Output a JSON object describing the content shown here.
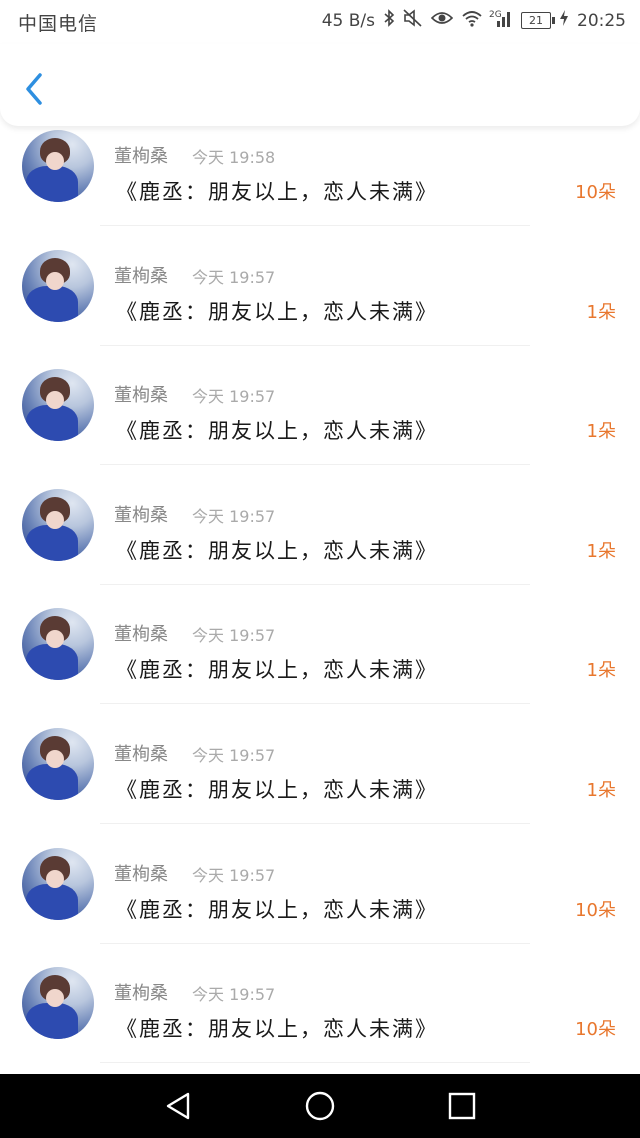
{
  "status_bar": {
    "carrier": "中国电信",
    "speed": "45 B/s",
    "network": "2G",
    "battery": "21",
    "time": "20:25",
    "icons": [
      "bluetooth-icon",
      "mute-icon",
      "eye-icon",
      "wifi-icon",
      "signal-icon",
      "battery-icon",
      "charging-icon"
    ]
  },
  "header": {
    "back_icon": "chevron-left-icon",
    "accent": "#2e8fe0"
  },
  "list": {
    "items": [
      {
        "name": "董栒桑",
        "time": "今天 19:58",
        "title": "《鹿丞：朋友以上，恋人未满》",
        "amount": "10朵"
      },
      {
        "name": "董栒桑",
        "time": "今天 19:57",
        "title": "《鹿丞：朋友以上，恋人未满》",
        "amount": "1朵"
      },
      {
        "name": "董栒桑",
        "time": "今天 19:57",
        "title": "《鹿丞：朋友以上，恋人未满》",
        "amount": "1朵"
      },
      {
        "name": "董栒桑",
        "time": "今天 19:57",
        "title": "《鹿丞：朋友以上，恋人未满》",
        "amount": "1朵"
      },
      {
        "name": "董栒桑",
        "time": "今天 19:57",
        "title": "《鹿丞：朋友以上，恋人未满》",
        "amount": "1朵"
      },
      {
        "name": "董栒桑",
        "time": "今天 19:57",
        "title": "《鹿丞：朋友以上，恋人未满》",
        "amount": "1朵"
      },
      {
        "name": "董栒桑",
        "time": "今天 19:57",
        "title": "《鹿丞：朋友以上，恋人未满》",
        "amount": "10朵"
      },
      {
        "name": "董栒桑",
        "time": "今天 19:57",
        "title": "《鹿丞：朋友以上，恋人未满》",
        "amount": "10朵"
      }
    ],
    "amount_color": "#e8772e"
  },
  "nav_bar": {
    "icons": [
      "back-triangle-icon",
      "home-circle-icon",
      "recents-square-icon"
    ]
  }
}
